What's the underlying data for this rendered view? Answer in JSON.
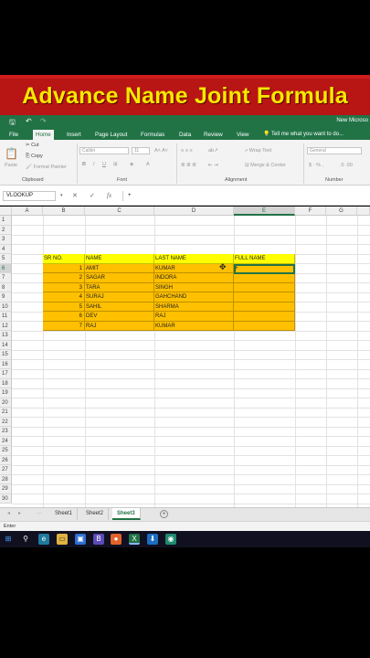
{
  "banner": {
    "title": "Advance Name Joint  Formula"
  },
  "app": {
    "title": "New Microso"
  },
  "quick_access": {
    "save": "🖫",
    "undo": "↶",
    "redo": "↷"
  },
  "tabs": [
    "File",
    "Home",
    "Insert",
    "Page Layout",
    "Formulas",
    "Data",
    "Review",
    "View"
  ],
  "active_tab": "Home",
  "tell_me": "Tell me what you want to do...",
  "ribbon": {
    "cut": "Cut",
    "copy": "Copy",
    "format_painter": "Format Painter",
    "paste": "Paste",
    "font_name": "Calibri",
    "font_size": "11",
    "wrap_text": "Wrap Text",
    "merge_center": "Merge & Center",
    "number_format": "General",
    "groups": {
      "clipboard": "Clipboard",
      "font": "Font",
      "alignment": "Alignment",
      "number": "Number"
    }
  },
  "formula_bar": {
    "name_box": "VLOOKUP",
    "cancel": "✕",
    "enter": "✓",
    "fx": "fx",
    "value": "+"
  },
  "columns": [
    "A",
    "B",
    "C",
    "D",
    "E",
    "F",
    "G"
  ],
  "selected_column": "E",
  "rows": [
    "1",
    "2",
    "3",
    "4",
    "5",
    "6",
    "7",
    "8",
    "9",
    "10",
    "11",
    "12",
    "13",
    "14",
    "15",
    "16",
    "17",
    "18",
    "19",
    "20",
    "21",
    "22",
    "23",
    "24",
    "25",
    "26",
    "27",
    "28",
    "29",
    "30"
  ],
  "selected_row": "6",
  "table": {
    "headers": [
      "SR NO.",
      "NAME",
      "LAST NAME",
      "FULL NAME"
    ],
    "rows": [
      {
        "sr": "1",
        "name": "AMIT",
        "last": "KUMAR",
        "full": "+"
      },
      {
        "sr": "2",
        "name": "SAGAR",
        "last": "INDORA",
        "full": ""
      },
      {
        "sr": "3",
        "name": "TARA",
        "last": "SINGH",
        "full": ""
      },
      {
        "sr": "4",
        "name": "SURAJ",
        "last": "GAHCHAND",
        "full": ""
      },
      {
        "sr": "5",
        "name": "SAHIL",
        "last": "SHARMA",
        "full": ""
      },
      {
        "sr": "6",
        "name": "DEV",
        "last": "RAJ",
        "full": ""
      },
      {
        "sr": "7",
        "name": "RAJ",
        "last": "KUMAR",
        "full": ""
      }
    ]
  },
  "sheets": [
    "Sheet1",
    "Sheet2",
    "Sheet3"
  ],
  "active_sheet": "Sheet3",
  "status": "Enter",
  "colors": {
    "excel_green": "#217346",
    "header_yellow": "#ffff00",
    "data_orange": "#ffc000",
    "banner_red": "#b81515",
    "banner_text": "#f6e800"
  }
}
